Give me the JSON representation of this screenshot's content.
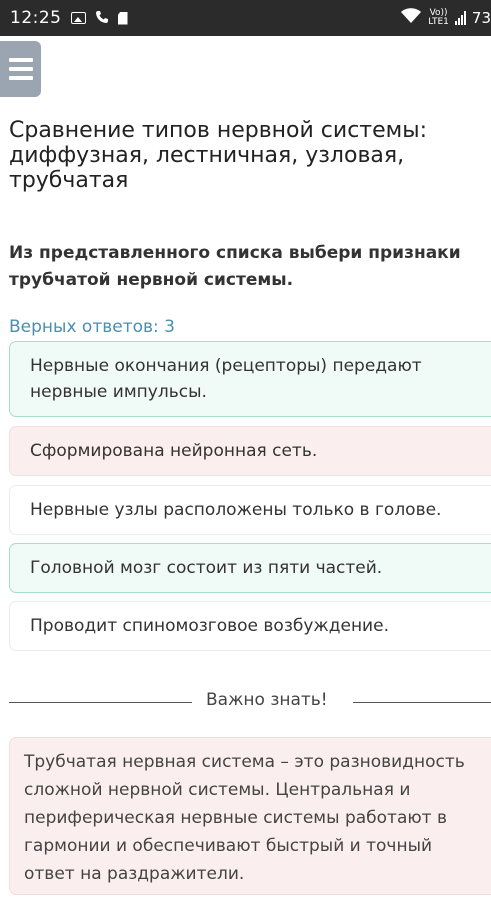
{
  "status_bar": {
    "time": "12:25",
    "network_top": "Vo))",
    "network_bottom": "LTE1",
    "battery": "73"
  },
  "header": {
    "title": "Сравнение типов нервной системы: диффузная, лестничная, узловая, трубчатая"
  },
  "question": {
    "line1": "Из представленного списка выбери признаки",
    "line2": "трубчатой нервной системы.",
    "answers_label": "Верных ответов: 3"
  },
  "options": [
    {
      "line1": "Нервные окончания (рецепторы) передают",
      "line2": "нервные импульсы.",
      "state": "correct"
    },
    {
      "text": "Сформирована нейронная сеть.",
      "state": "incorrect"
    },
    {
      "text": "Нервные узлы расположены только в голове.",
      "state": "neutral"
    },
    {
      "text": "Головной мозг состоит из пяти частей.",
      "state": "correct"
    },
    {
      "text": "Проводит спиномозговое возбуждение.",
      "state": "neutral"
    }
  ],
  "divider": {
    "label": "Важно знать!"
  },
  "info": {
    "line1": "Трубчатая нервная система – это разновидность",
    "line2": "сложной нервной системы. Центральная и",
    "line3": "периферическая нервные системы работают в",
    "line4": "гармонии и обеспечивают быстрый и точный",
    "line5": "ответ на раздражители."
  },
  "colors": {
    "correct_bg": "#f0faf7",
    "correct_border": "#a8ddc9",
    "incorrect_bg": "#fbeeee",
    "accent_text": "#4a8fb0",
    "menu_button": "#9aa5b1"
  }
}
